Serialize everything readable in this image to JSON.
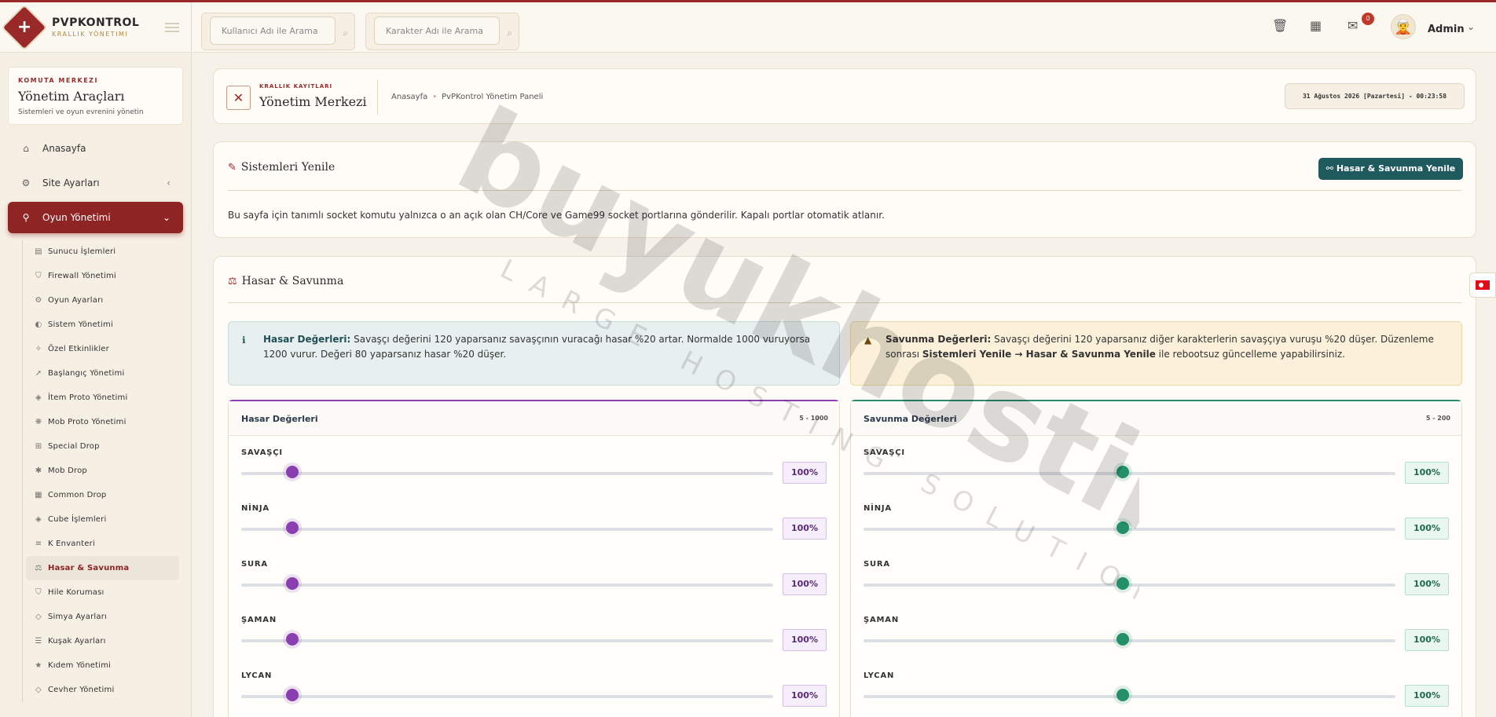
{
  "brand": {
    "name": "PVPKONTROL",
    "subtitle": "KRALLIK YÖNETIMI"
  },
  "sidebar": {
    "kicker": "KOMUTA MERKEZI",
    "title": "Yönetim Araçları",
    "description": "Sistemleri ve oyun evrenini yönetin",
    "items": [
      {
        "label": "Anasayfa",
        "icon": "home-icon"
      },
      {
        "label": "Site Ayarları",
        "icon": "gear-icon"
      },
      {
        "label": "Oyun Yönetimi",
        "icon": "gamepad-icon"
      }
    ],
    "subitems": [
      {
        "label": "Sunucu İşlemleri",
        "icon": "server-icon"
      },
      {
        "label": "Firewall Yönetimi",
        "icon": "shield-icon"
      },
      {
        "label": "Oyun Ayarları",
        "icon": "cogs-icon"
      },
      {
        "label": "Sistem Yönetimi",
        "icon": "toggle-icon"
      },
      {
        "label": "Özel Etkinlikler",
        "icon": "magic-icon"
      },
      {
        "label": "Başlangıç Yönetimi",
        "icon": "rocket-icon"
      },
      {
        "label": "İtem Proto Yönetimi",
        "icon": "cube-icon"
      },
      {
        "label": "Mob Proto Yönetimi",
        "icon": "paw-icon"
      },
      {
        "label": "Special Drop",
        "icon": "gift-icon"
      },
      {
        "label": "Mob Drop",
        "icon": "bug-icon"
      },
      {
        "label": "Common Drop",
        "icon": "table-icon"
      },
      {
        "label": "Cube İşlemleri",
        "icon": "cube-icon"
      },
      {
        "label": "K Envanteri",
        "icon": "list-icon"
      },
      {
        "label": "Hasar & Savunma",
        "icon": "scale-icon"
      },
      {
        "label": "Hile Koruması",
        "icon": "shield-icon"
      },
      {
        "label": "Simya Ayarları",
        "icon": "gem-icon"
      },
      {
        "label": "Kuşak Ayarları",
        "icon": "sliders-icon"
      },
      {
        "label": "Kıdem Yönetimi",
        "icon": "star-icon"
      },
      {
        "label": "Cevher Yönetimi",
        "icon": "gem-icon"
      }
    ]
  },
  "topbar": {
    "search_user_placeholder": "Kullanıcı Adı ile Arama",
    "search_char_placeholder": "Karakter Adı ile Arama",
    "notification_count": "0",
    "user_name": "Admin"
  },
  "header": {
    "kicker": "KRALLIK KAYITLARI",
    "title": "Yönetim Merkezi",
    "breadcrumb_home": "Anasayfa",
    "breadcrumb_current": "PvPKontrol Yönetim Paneli",
    "datetime": "31 Ağustos 2026 [Pazartesi] - 00:23:58"
  },
  "systems": {
    "title": "Sistemleri Yenile",
    "button": "Hasar & Savunma Yenile",
    "description": "Bu sayfa için tanımlı socket komutu yalnızca o an açık olan CH/Core ve Game99 socket portlarına gönderilir. Kapalı portlar otomatik atlanır."
  },
  "damage_defense": {
    "title": "Hasar & Savunma",
    "info_alert": {
      "bold": "Hasar Değerleri:",
      "text": " Savaşçı değerini 120 yaparsanız savaşçının vuracağı hasar %20 artar. Normalde 1000 vuruyorsa 1200 vurur. Değeri 80 yaparsanız hasar %20 düşer."
    },
    "warn_alert": {
      "bold": "Savunma Değerleri:",
      "text1": " Savaşçı değerini 120 yaparsanız diğer karakterlerin savaşçıya vuruşu %20 düşer. Düzenleme sonrası ",
      "bold2": "Sistemleri Yenile → Hasar & Savunma Yenile",
      "text2": " ile rebootsuz güncelleme yapabilirsiniz."
    },
    "damage_panel": {
      "title": "Hasar Değerleri",
      "range": "5 - 1000",
      "min": 5,
      "max": 1000,
      "rows": [
        {
          "label": "SAVAŞÇI",
          "value": 100,
          "display": "100%"
        },
        {
          "label": "NİNJA",
          "value": 100,
          "display": "100%"
        },
        {
          "label": "SURA",
          "value": 100,
          "display": "100%"
        },
        {
          "label": "ŞAMAN",
          "value": 100,
          "display": "100%"
        },
        {
          "label": "LYCAN",
          "value": 100,
          "display": "100%"
        }
      ]
    },
    "defense_panel": {
      "title": "Savunma Değerleri",
      "range": "5 - 200",
      "min": 5,
      "max": 200,
      "rows": [
        {
          "label": "SAVAŞÇI",
          "value": 100,
          "display": "100%"
        },
        {
          "label": "NİNJA",
          "value": 100,
          "display": "100%"
        },
        {
          "label": "SURA",
          "value": 100,
          "display": "100%"
        },
        {
          "label": "ŞAMAN",
          "value": 100,
          "display": "100%"
        },
        {
          "label": "LYCAN",
          "value": 100,
          "display": "100%"
        }
      ]
    }
  },
  "watermark": {
    "line1": "buyukhosting",
    "line2": "LARGE HOSTING SOLUTIONS"
  }
}
